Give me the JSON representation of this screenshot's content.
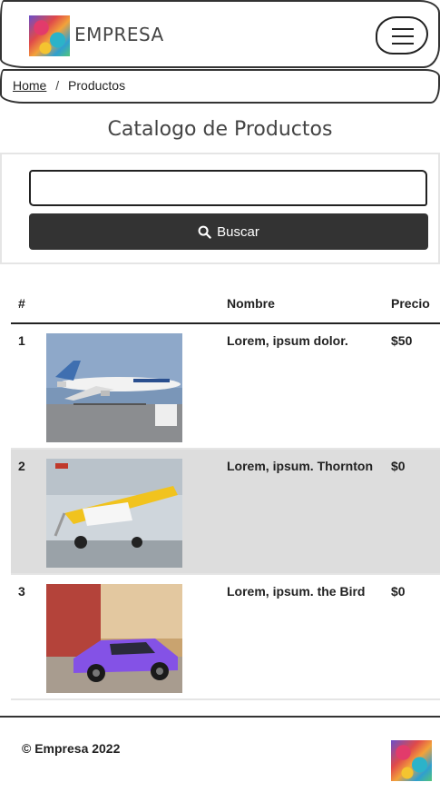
{
  "header": {
    "brand_name": "EMPRESA",
    "logo_icon": "colorful-abstract-logo",
    "menu_icon": "hamburger-menu-icon"
  },
  "breadcrumb": {
    "home": "Home",
    "separator": "/",
    "current": "Productos"
  },
  "main": {
    "title": "Catalogo de Productos",
    "search": {
      "placeholder": "",
      "value": "",
      "button_label": "Buscar",
      "button_icon": "search-icon"
    },
    "table": {
      "headers": [
        "#",
        "",
        "Nombre",
        "Precio"
      ],
      "rows": [
        {
          "num": "1",
          "image": "airplane-south-african",
          "name": "Lorem, ipsum dolor.",
          "price": "$50"
        },
        {
          "num": "2",
          "image": "yellow-small-airplane",
          "name": "Lorem, ipsum. Thornton",
          "price": "$0"
        },
        {
          "num": "3",
          "image": "purple-sports-car",
          "name": "Lorem, ipsum. the Bird",
          "price": "$0"
        }
      ]
    }
  },
  "footer": {
    "copyright": "© Empresa 2022",
    "logo_icon": "colorful-abstract-logo"
  },
  "colors": {
    "dark": "#333333",
    "row_alt": "#dddddd",
    "border_light": "#e5e5e5"
  }
}
